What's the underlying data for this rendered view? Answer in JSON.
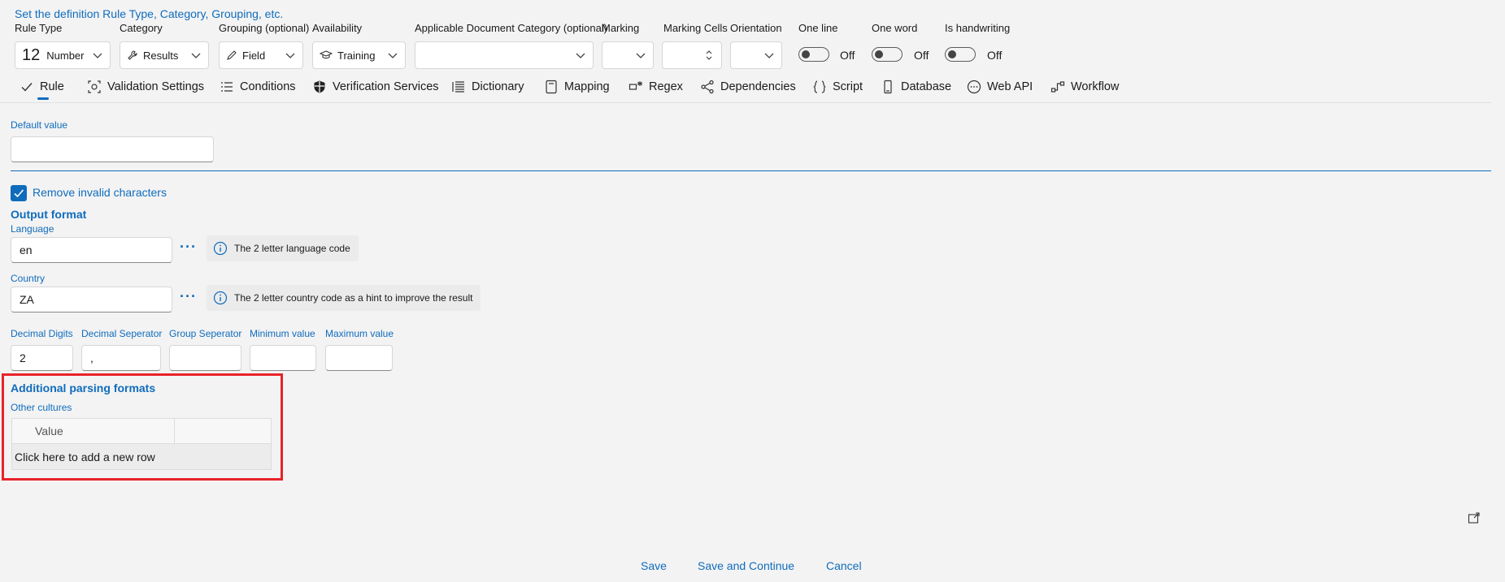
{
  "header": {
    "title": "Set the definition Rule Type, Category, Grouping, etc."
  },
  "fields": {
    "rule_type": {
      "label": "Rule Type",
      "value": "Number",
      "icon": "number-12-icon"
    },
    "category": {
      "label": "Category",
      "value": "Results",
      "icon": "wrench-icon"
    },
    "grouping": {
      "label": "Grouping (optional)",
      "value": "Field",
      "icon": "pencil-icon"
    },
    "availability": {
      "label": "Availability",
      "value": "Training",
      "icon": "graduation-cap-icon"
    },
    "applicable_doc_cat": {
      "label": "Applicable Document Category (optional)",
      "value": ""
    },
    "marking": {
      "label": "Marking",
      "value": ""
    },
    "marking_cells": {
      "label": "Marking Cells",
      "value": ""
    },
    "orientation": {
      "label": "Orientation",
      "value": ""
    },
    "one_line": {
      "label": "One line",
      "state": "Off"
    },
    "one_word": {
      "label": "One word",
      "state": "Off"
    },
    "is_handwriting": {
      "label": "Is handwriting",
      "state": "Off"
    }
  },
  "rule_type_glyph": "12",
  "tabs": [
    {
      "label": "Rule",
      "icon": "checkmark-icon",
      "active": true
    },
    {
      "label": "Validation Settings",
      "icon": "validation-icon"
    },
    {
      "label": "Conditions",
      "icon": "list-icon"
    },
    {
      "label": "Verification Services",
      "icon": "shield-icon"
    },
    {
      "label": "Dictionary",
      "icon": "dictionary-icon"
    },
    {
      "label": "Mapping",
      "icon": "book-icon"
    },
    {
      "label": "Regex",
      "icon": "regex-icon"
    },
    {
      "label": "Dependencies",
      "icon": "share-icon"
    },
    {
      "label": "Script",
      "icon": "braces-icon"
    },
    {
      "label": "Database",
      "icon": "database-icon"
    },
    {
      "label": "Web API",
      "icon": "web-api-icon"
    },
    {
      "label": "Workflow",
      "icon": "workflow-icon"
    }
  ],
  "default_value": {
    "label": "Default value",
    "value": ""
  },
  "remove_invalid": {
    "label": "Remove invalid characters",
    "checked": true
  },
  "output_format": {
    "heading": "Output format",
    "language": {
      "label": "Language",
      "value": "en",
      "hint": "The 2 letter language code"
    },
    "country": {
      "label": "Country",
      "value": "ZA",
      "hint": "The 2 letter country code as a hint to improve the result"
    }
  },
  "number_fields": {
    "decimal_digits": {
      "label": "Decimal Digits",
      "value": "2"
    },
    "decimal_separator": {
      "label": "Decimal Seperator",
      "value": ","
    },
    "group_separator": {
      "label": "Group Seperator",
      "value": ""
    },
    "minimum_value": {
      "label": "Minimum value",
      "value": ""
    },
    "maximum_value": {
      "label": "Maximum value",
      "value": ""
    }
  },
  "parsing": {
    "heading": "Additional parsing formats",
    "other_cultures_label": "Other cultures",
    "column_header": "Value",
    "add_row": "Click here to add a new row"
  },
  "footer": {
    "save": "Save",
    "save_continue": "Save and Continue",
    "cancel": "Cancel"
  },
  "colors": {
    "accent": "#0f6cbd",
    "highlight": "#e8232a"
  }
}
